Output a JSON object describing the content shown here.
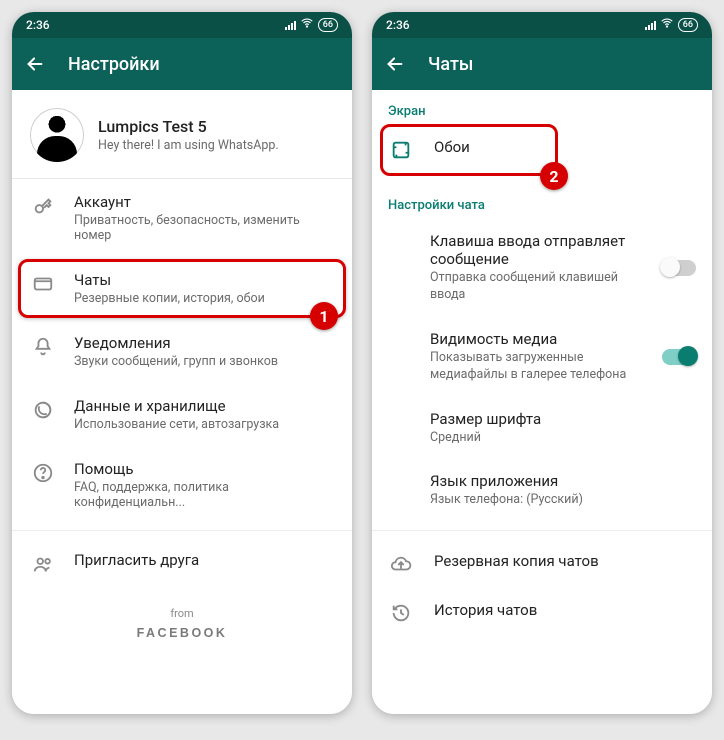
{
  "status": {
    "time": "2:36",
    "battery": "66"
  },
  "left": {
    "title": "Настройки",
    "profile": {
      "name": "Lumpics Test 5",
      "status": "Hey there! I am using WhatsApp."
    },
    "items": [
      {
        "title": "Аккаунт",
        "sub": "Приватность, безопасность, изменить номер"
      },
      {
        "title": "Чаты",
        "sub": "Резервные копии, история, обои"
      },
      {
        "title": "Уведомления",
        "sub": "Звуки сообщений, групп и звонков"
      },
      {
        "title": "Данные и хранилище",
        "sub": "Использование сети, автозагрузка"
      },
      {
        "title": "Помощь",
        "sub": "FAQ, поддержка, политика конфиденциальн..."
      },
      {
        "title": "Пригласить друга",
        "sub": ""
      }
    ],
    "footer_from": "from",
    "footer_fb": "FACEBOOK",
    "badge": "1"
  },
  "right": {
    "title": "Чаты",
    "section_screen": "Экран",
    "wallpaper": "Обои",
    "section_chat": "Настройки чата",
    "items": [
      {
        "title": "Клавиша ввода отправляет сообщение",
        "sub": "Отправка сообщений клавишей ввода",
        "toggle": "off"
      },
      {
        "title": "Видимость медиа",
        "sub": "Показывать загруженные медиафайлы в галерее телефона",
        "toggle": "on"
      },
      {
        "title": "Размер шрифта",
        "sub": "Средний"
      },
      {
        "title": "Язык приложения",
        "sub": "Язык телефона: (Русский)"
      }
    ],
    "backup": "Резервная копия чатов",
    "history": "История чатов",
    "badge": "2"
  }
}
